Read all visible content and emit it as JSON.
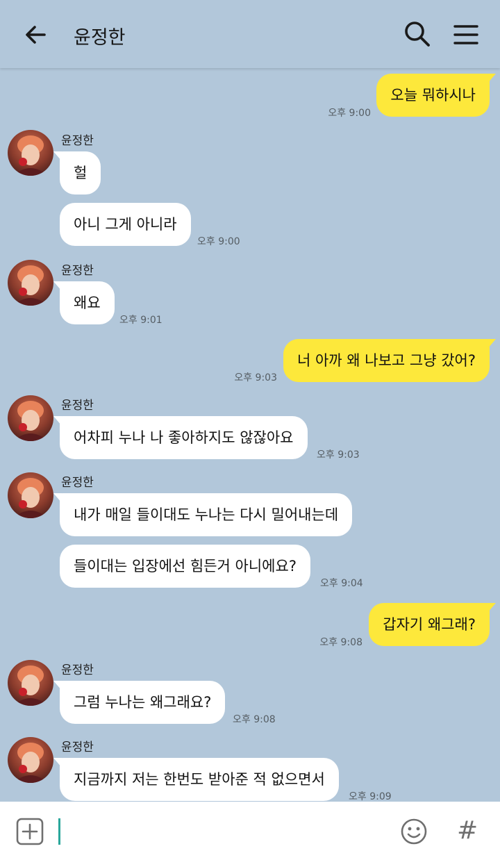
{
  "header": {
    "title": "윤정한",
    "back_icon": "arrow-left-icon",
    "search_icon": "search-icon",
    "menu_icon": "hamburger-menu-icon"
  },
  "messages": [
    {
      "from": "me",
      "text": "오늘 뭐하시나",
      "time": "오후 9:00"
    },
    {
      "from": "other",
      "sender": "윤정한",
      "text": "헐"
    },
    {
      "from": "other",
      "text": "아니 그게 아니라",
      "time": "오후 9:00"
    },
    {
      "from": "other",
      "sender": "윤정한",
      "text": "왜요",
      "time": "오후 9:01"
    },
    {
      "from": "me",
      "text": "너 아까 왜 나보고 그냥 갔어?",
      "time": "오후 9:03"
    },
    {
      "from": "other",
      "sender": "윤정한",
      "text": "어차피 누나 나 좋아하지도 않잖아요",
      "time": "오후 9:03"
    },
    {
      "from": "other",
      "sender": "윤정한",
      "text": "내가 매일 들이대도 누나는 다시 밀어내는데"
    },
    {
      "from": "other",
      "text": "들이대는 입장에선 힘든거 아니에요?",
      "time": "오후 9:04"
    },
    {
      "from": "me",
      "text": "갑자기 왜그래?",
      "time": "오후 9:08"
    },
    {
      "from": "other",
      "sender": "윤정한",
      "text": "그럼 누나는 왜그래요?",
      "time": "오후 9:08"
    },
    {
      "from": "other",
      "sender": "윤정한",
      "text": "지금까지 저는 한번도 받아준 적 없으면서",
      "time": "오후 9:09"
    }
  ],
  "input": {
    "plus_icon": "plus-square-icon",
    "emoji_icon": "smiley-icon",
    "hash_label": "#"
  },
  "colors": {
    "background": "#b2c7da",
    "sent_bubble": "#fde83b",
    "received_bubble": "#ffffff",
    "cursor": "#2aa79b"
  }
}
